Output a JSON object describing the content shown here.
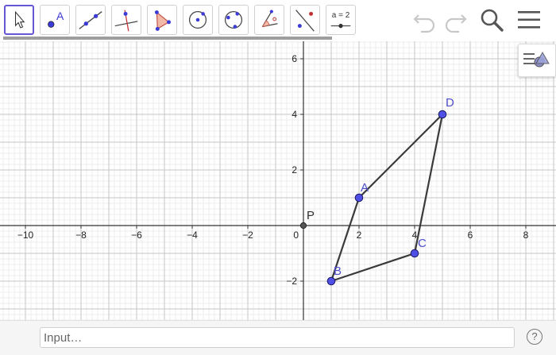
{
  "toolbar": {
    "tools": [
      {
        "name": "move-tool",
        "icon": "cursor-arrow-icon",
        "selected": true
      },
      {
        "name": "point-tool",
        "icon": "point-icon",
        "label": "A"
      },
      {
        "name": "line-tool",
        "icon": "line-icon"
      },
      {
        "name": "perpendicular-line-tool",
        "icon": "perpendicular-line-icon"
      },
      {
        "name": "polygon-tool",
        "icon": "polygon-icon"
      },
      {
        "name": "circle-center-point-tool",
        "icon": "circle-center-icon"
      },
      {
        "name": "circle-three-points-tool",
        "icon": "circle-three-points-icon"
      },
      {
        "name": "angle-tool",
        "icon": "angle-icon"
      },
      {
        "name": "reflect-tool",
        "icon": "reflect-icon"
      },
      {
        "name": "slider-tool",
        "icon": "slider-icon",
        "label": "a = 2"
      }
    ],
    "right_buttons": [
      "undo-icon",
      "redo-icon",
      "search-icon",
      "menu-icon"
    ]
  },
  "graphics": {
    "x_ticks": [
      -10,
      -8,
      -6,
      -4,
      -2,
      2,
      4,
      6,
      8
    ],
    "y_ticks": [
      6,
      4,
      2,
      -2
    ],
    "origin_label": "0",
    "points": [
      {
        "label": "A",
        "x": 2,
        "y": 1
      },
      {
        "label": "B",
        "x": 1,
        "y": -2
      },
      {
        "label": "C",
        "x": 4,
        "y": -1
      },
      {
        "label": "D",
        "x": 5,
        "y": 4
      }
    ],
    "origin_point": {
      "label": "P",
      "x": 0,
      "y": 0
    },
    "polygon_order": [
      "A",
      "D",
      "C",
      "B"
    ],
    "colors": {
      "point_fill": "#4f4fe6",
      "point_label": "#4d4dcc",
      "segment": "#3a3a3a",
      "accent": "#6557d2"
    }
  },
  "input_bar": {
    "placeholder": "Input…"
  },
  "help": {
    "symbol": "?"
  }
}
